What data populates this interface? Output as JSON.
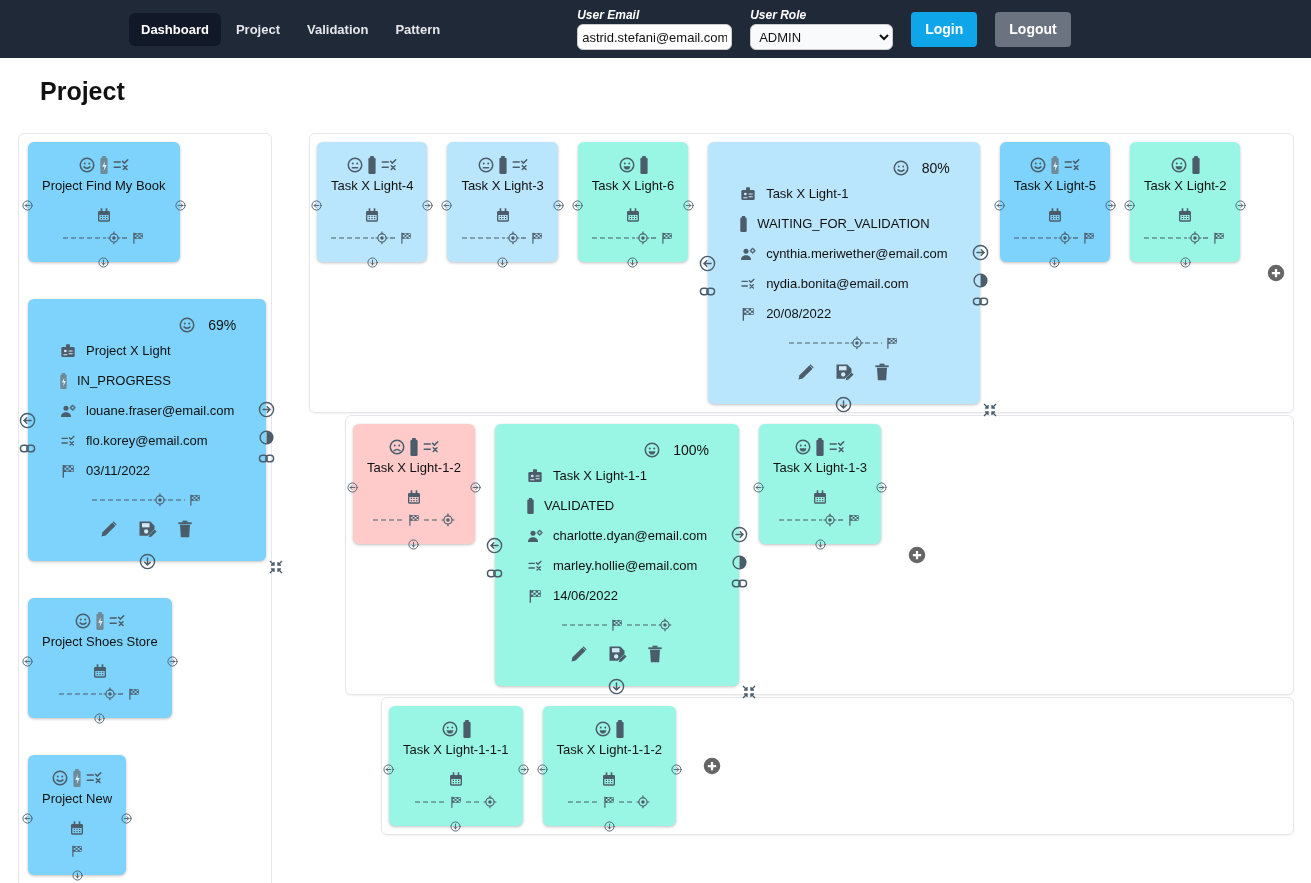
{
  "nav": {
    "items": [
      {
        "label": "Dashboard",
        "selected": true
      },
      {
        "label": "Project",
        "selected": false
      },
      {
        "label": "Validation",
        "selected": false
      },
      {
        "label": "Pattern",
        "selected": false
      }
    ]
  },
  "login": {
    "email_label": "User Email",
    "email_value": "astrid.stefani@email.com",
    "role_label": "User Role",
    "role_value": "ADMIN",
    "buttons": [
      {
        "label": "Login",
        "kind": "primary"
      },
      {
        "label": "Logout",
        "kind": "secondary"
      }
    ]
  },
  "page_title": "Project",
  "projects": [
    {
      "kind": "compact",
      "title": "Project Find My Book",
      "color": "#7dd3fc",
      "mood": {
        "kind": "smile"
      },
      "battery": {
        "kind": "charging"
      },
      "validator_icon": true,
      "timeline": {
        "kind": "target_then_flag"
      }
    },
    {
      "kind": "expanded",
      "title": "Project X Light",
      "progress": "69%",
      "status": "IN_PROGRESS",
      "owner": "louane.fraser@email.com",
      "validator": "flo.korey@email.com",
      "date": "03/11/2022",
      "color": "#7dd3fc",
      "mood": {
        "kind": "smile"
      },
      "battery": {
        "kind": "charging"
      },
      "timeline": {
        "kind": "target_then_flag"
      }
    },
    {
      "kind": "compact",
      "title": "Project Shoes Store",
      "color": "#7dd3fc",
      "mood": {
        "kind": "smile"
      },
      "battery": {
        "kind": "charging"
      },
      "validator_icon": true,
      "timeline": {
        "kind": "target_then_flag"
      }
    },
    {
      "kind": "compact",
      "title": "Project New",
      "color": "#7dd3fc",
      "mood": {
        "kind": "smile"
      },
      "battery": {
        "kind": "charging"
      },
      "validator_icon": true,
      "timeline": {
        "kind": "flag_only"
      }
    }
  ],
  "task_tree": {
    "tasks": [
      {
        "kind": "compact",
        "title": "Task X Light-4",
        "color": "#bae6fd",
        "mood": {
          "kind": "neutral"
        },
        "battery": {
          "kind": "full"
        },
        "validator_icon": true,
        "timeline": {
          "kind": "target_then_flag"
        }
      },
      {
        "kind": "compact",
        "title": "Task X Light-3",
        "color": "#bae6fd",
        "mood": {
          "kind": "neutral"
        },
        "battery": {
          "kind": "full"
        },
        "validator_icon": true,
        "timeline": {
          "kind": "target_then_flag"
        }
      },
      {
        "kind": "compact",
        "title": "Task X Light-6",
        "color": "#99f6e4",
        "mood": {
          "kind": "happy"
        },
        "battery": {
          "kind": "full"
        },
        "validator_icon": false,
        "timeline": {
          "kind": "target_then_flag"
        }
      },
      {
        "kind": "expanded",
        "title": "Task X Light-1",
        "progress": "80%",
        "status": "WAITING_FOR_VALIDATION",
        "owner": "cynthia.meriwether@email.com",
        "validator": "nydia.bonita@email.com",
        "date": "20/08/2022",
        "color": "#bae6fd",
        "mood": {
          "kind": "smile"
        },
        "battery": {
          "kind": "full"
        },
        "timeline": {
          "kind": "target_then_flag"
        }
      },
      {
        "kind": "compact",
        "title": "Task X Light-5",
        "color": "#7dd3fc",
        "mood": {
          "kind": "smile"
        },
        "battery": {
          "kind": "charging"
        },
        "validator_icon": true,
        "timeline": {
          "kind": "target_then_flag"
        }
      },
      {
        "kind": "compact",
        "title": "Task X Light-2",
        "color": "#99f6e4",
        "mood": {
          "kind": "happy"
        },
        "battery": {
          "kind": "full"
        },
        "validator_icon": false,
        "timeline": {
          "kind": "target_then_flag"
        }
      }
    ],
    "children": [
      {
        "tasks": [
          {
            "kind": "compact",
            "title": "Task X Light-1-2",
            "color": "#fecaca",
            "mood": {
              "kind": "sad"
            },
            "battery": {
              "kind": "full"
            },
            "validator_icon": true,
            "timeline": {
              "kind": "flag_then_target"
            }
          },
          {
            "kind": "expanded",
            "title": "Task X Light-1-1",
            "progress": "100%",
            "status": "VALIDATED",
            "owner": "charlotte.dyan@email.com",
            "validator": "marley.hollie@email.com",
            "date": "14/06/2022",
            "color": "#99f6e4",
            "mood": {
              "kind": "happy"
            },
            "battery": {
              "kind": "full"
            },
            "timeline": {
              "kind": "flag_then_target"
            }
          },
          {
            "kind": "compact",
            "title": "Task X Light-1-3",
            "color": "#99f6e4",
            "mood": {
              "kind": "happy"
            },
            "battery": {
              "kind": "full"
            },
            "validator_icon": true,
            "timeline": {
              "kind": "target_then_flag"
            }
          }
        ],
        "children": [
          {
            "tasks": [
              {
                "kind": "compact",
                "title": "Task X Light-1-1-1",
                "color": "#99f6e4",
                "mood": {
                  "kind": "happy"
                },
                "battery": {
                  "kind": "full"
                },
                "validator_icon": false,
                "timeline": {
                  "kind": "flag_then_target"
                }
              },
              {
                "kind": "compact",
                "title": "Task X Light-1-1-2",
                "color": "#99f6e4",
                "mood": {
                  "kind": "happy"
                },
                "battery": {
                  "kind": "full"
                },
                "validator_icon": false,
                "timeline": {
                  "kind": "flag_then_target"
                }
              }
            ]
          }
        ]
      }
    ]
  }
}
